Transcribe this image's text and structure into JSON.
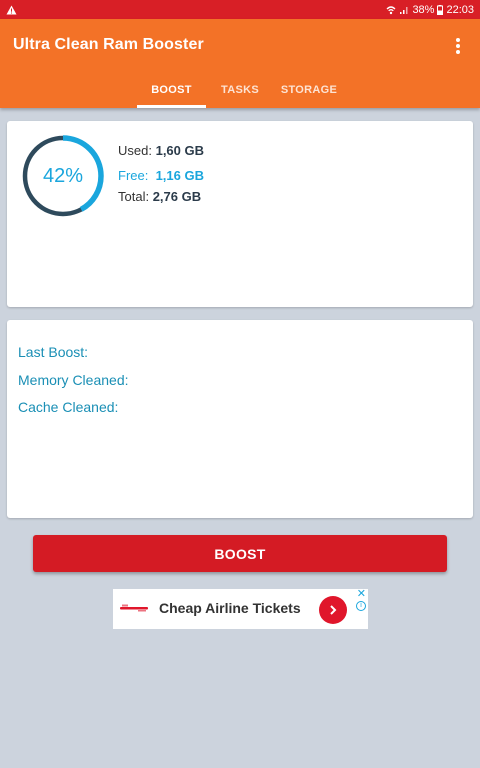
{
  "status_bar": {
    "battery": "38%",
    "time": "22:03"
  },
  "app": {
    "title": "Ultra Clean Ram Booster"
  },
  "tabs": [
    {
      "label": "BOOST",
      "active": true
    },
    {
      "label": "TASKS",
      "active": false
    },
    {
      "label": "STORAGE",
      "active": false
    }
  ],
  "ram": {
    "percent_label": "42%",
    "percent_value": 0.42,
    "used_label": "Used:",
    "used_value": "1,60 GB",
    "free_label": "Free:",
    "free_value": "1,16 GB",
    "total_label": "Total:",
    "total_value": "2,76 GB"
  },
  "history": {
    "last_boost_label": "Last Boost:",
    "memory_cleaned_label": "Memory Cleaned:",
    "cache_cleaned_label": "Cache Cleaned:"
  },
  "boost_button": {
    "label": "BOOST"
  },
  "ad": {
    "text": "Cheap Airline Tickets"
  },
  "colors": {
    "status_bar": "#d81f26",
    "toolbar": "#f37227",
    "accent": "#1aa6dd",
    "gauge_track": "#2e4a5c",
    "boost_button": "#d41b24",
    "background": "#ccd3dd"
  }
}
